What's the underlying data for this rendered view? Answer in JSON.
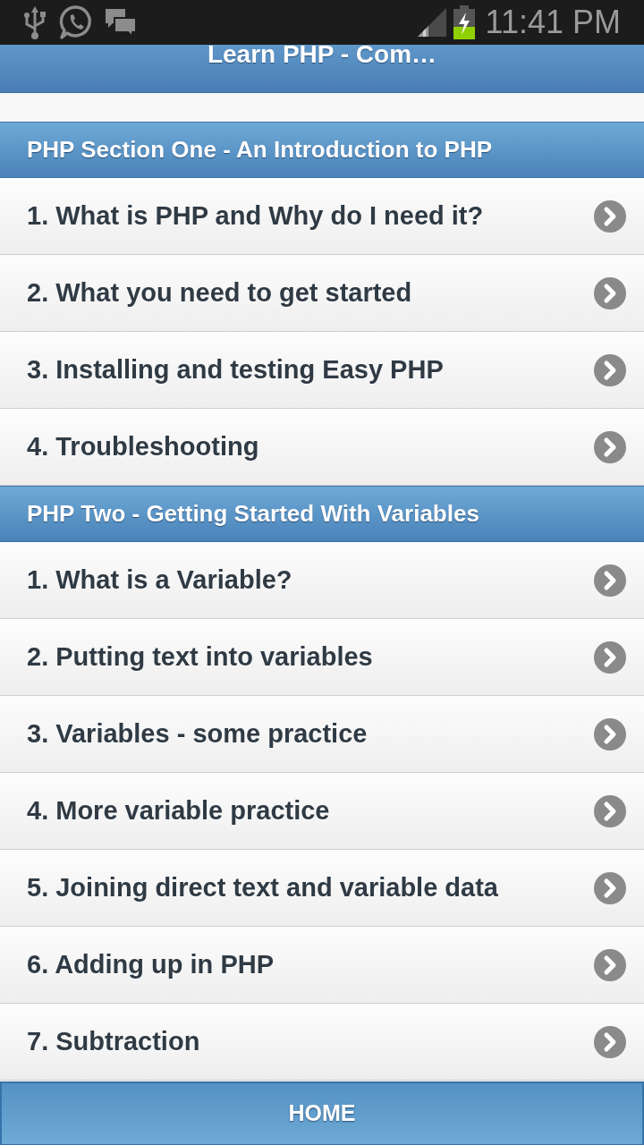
{
  "status_bar": {
    "time": "11:41 PM"
  },
  "header": {
    "title": "Learn PHP - Com…"
  },
  "sections": [
    {
      "title": "PHP Section One - An Introduction to PHP",
      "items": [
        {
          "label": "1. What is PHP and Why do I need it?"
        },
        {
          "label": "2. What you need to get started"
        },
        {
          "label": "3. Installing and testing Easy PHP"
        },
        {
          "label": "4. Troubleshooting"
        }
      ]
    },
    {
      "title": "PHP Two - Getting Started With Variables",
      "items": [
        {
          "label": "1. What is a Variable?"
        },
        {
          "label": "2. Putting text into variables"
        },
        {
          "label": "3. Variables - some practice"
        },
        {
          "label": "4. More variable practice"
        },
        {
          "label": "5. Joining direct text and variable data"
        },
        {
          "label": "6. Adding up in PHP"
        },
        {
          "label": "7. Subtraction"
        }
      ]
    }
  ],
  "footer": {
    "button": "HOME"
  }
}
